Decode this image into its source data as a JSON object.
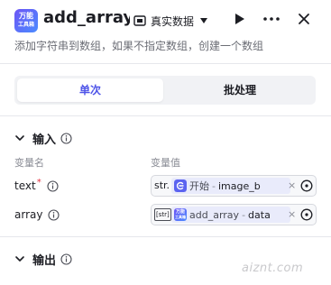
{
  "header": {
    "app_icon_text": [
      "万能",
      "工具箱"
    ],
    "title": "add_array…",
    "mode_label": "真实数据",
    "icons": {
      "mode": "database-icon",
      "run": "play-icon",
      "more": "more-horizontal-icon",
      "close": "close-icon"
    }
  },
  "description": "添加字符串到数组，如果不指定数组，创建一个数组",
  "tabs": [
    {
      "label": "单次",
      "active": true
    },
    {
      "label": "批处理",
      "active": false
    }
  ],
  "input_section": {
    "title": "输入",
    "columns": {
      "name": "变量名",
      "value": "变量值"
    },
    "params": [
      {
        "name": "text",
        "required": true,
        "type_tag": "str.",
        "ref_node": "开始",
        "ref_field": "image_b",
        "node_icon": "start-node-icon"
      },
      {
        "name": "array",
        "required": false,
        "type_tag": "[str]",
        "ref_node": "add_array",
        "ref_field": "data",
        "node_icon": "toolbox-node-icon"
      }
    ]
  },
  "output_section": {
    "title": "输出"
  },
  "watermark": "aiznt.com",
  "colors": {
    "accent": "#4d53e8",
    "required": "#e53241",
    "chip_bg": "#e9ebfb"
  }
}
